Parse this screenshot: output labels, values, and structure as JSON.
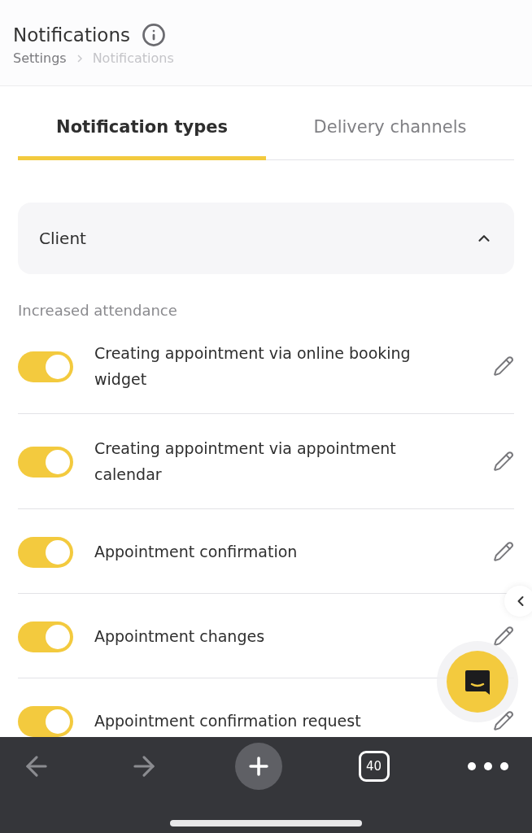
{
  "header": {
    "title": "Notifications",
    "breadcrumb": [
      "Settings",
      "Notifications"
    ]
  },
  "tabs": [
    {
      "label": "Notification types",
      "selected": true
    },
    {
      "label": "Delivery channels",
      "selected": false
    }
  ],
  "group": {
    "title": "Client",
    "expanded": true
  },
  "section": "Increased attendance",
  "items": [
    {
      "label": "Creating appointment via online booking widget",
      "on": true
    },
    {
      "label": "Creating appointment via appointment calendar",
      "on": true
    },
    {
      "label": "Appointment confirmation",
      "on": true
    },
    {
      "label": "Appointment changes",
      "on": true
    },
    {
      "label": "Appointment confirmation request",
      "on": true
    }
  ],
  "browser_bar": {
    "tab_count": "40"
  }
}
